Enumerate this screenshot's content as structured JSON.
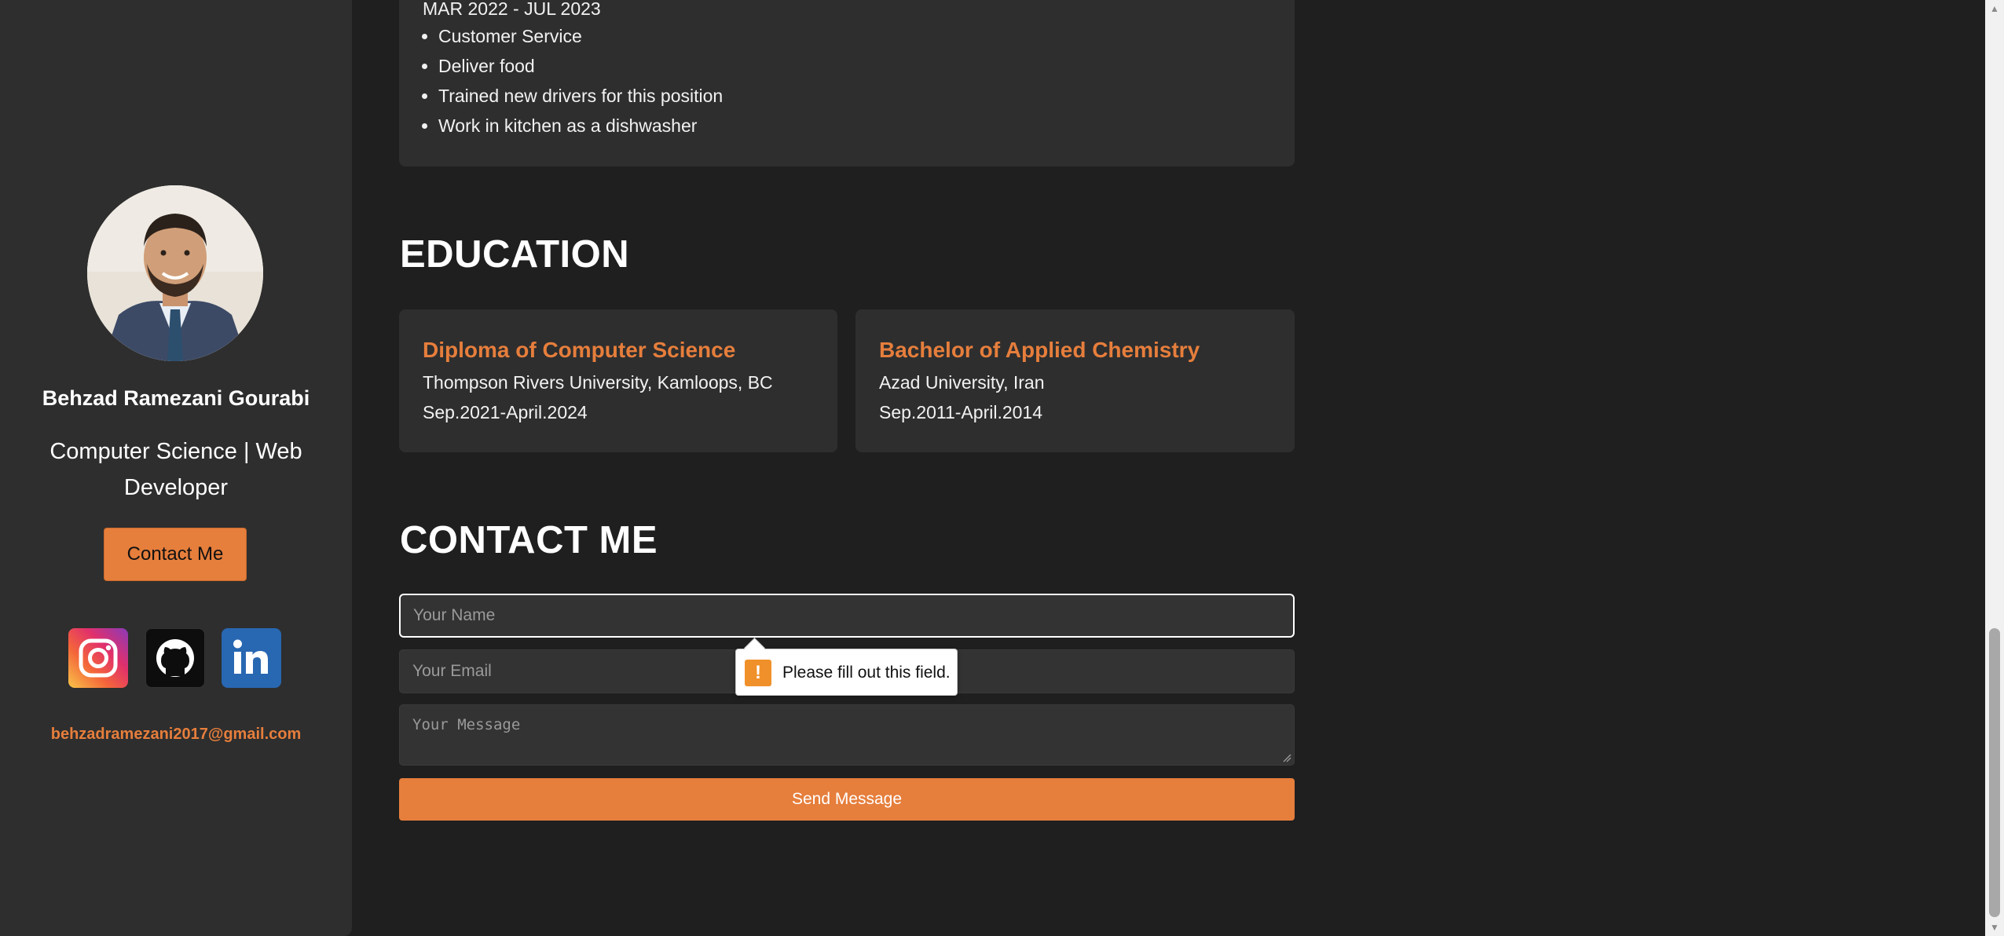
{
  "sidebar": {
    "name": "Behzad Ramezani Gourabi",
    "role": "Computer Science | Web Developer",
    "contact_button": "Contact Me",
    "social_icons": [
      "instagram-icon",
      "github-icon",
      "linkedin-icon"
    ],
    "email": "behzadramezani2017@gmail.com"
  },
  "experience": {
    "date_range": "MAR 2022 - JUL 2023",
    "duties": [
      "Customer Service",
      "Deliver food",
      "Trained new drivers for this position",
      "Work in kitchen as a dishwasher"
    ]
  },
  "education": {
    "heading": "EDUCATION",
    "items": [
      {
        "degree": "Diploma of Computer Science",
        "school": "Thompson Rivers University, Kamloops, BC",
        "dates": "Sep.2021-April.2024"
      },
      {
        "degree": "Bachelor of Applied Chemistry",
        "school": "Azad University, Iran",
        "dates": "Sep.2011-April.2014"
      }
    ]
  },
  "contact": {
    "heading": "CONTACT ME",
    "name_placeholder": "Your Name",
    "email_placeholder": "Your Email",
    "message_placeholder": "Your Message",
    "send_button": "Send Message"
  },
  "validation_tooltip": {
    "icon": "!",
    "text": "Please fill out this field."
  },
  "colors": {
    "accent": "#e67e3c",
    "background": "#1f1f1f",
    "card": "#2e2e2e"
  }
}
